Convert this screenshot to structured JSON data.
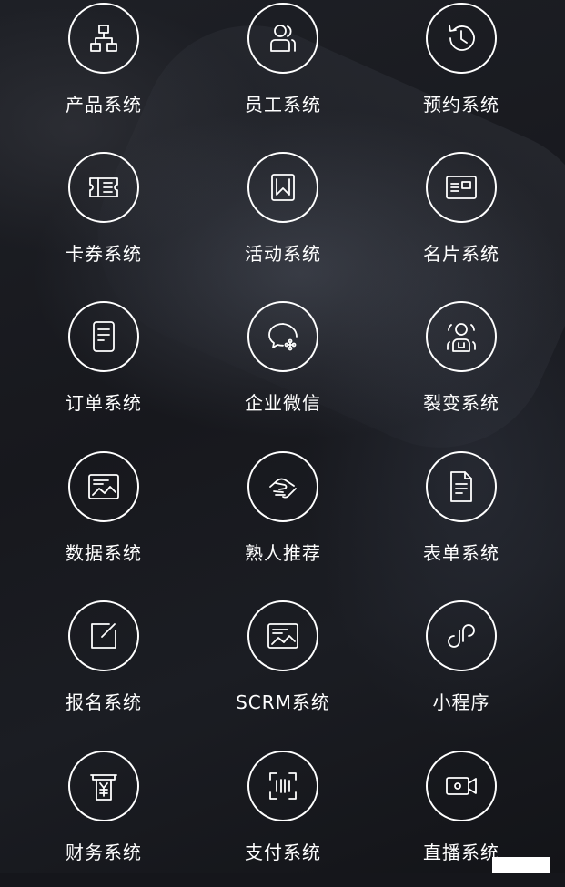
{
  "items": [
    {
      "label": "产品系统",
      "icon": "org-chart-icon"
    },
    {
      "label": "员工系统",
      "icon": "staff-icon"
    },
    {
      "label": "预约系统",
      "icon": "history-clock-icon"
    },
    {
      "label": "卡券系统",
      "icon": "coupon-icon"
    },
    {
      "label": "活动系统",
      "icon": "bookmark-icon"
    },
    {
      "label": "名片系统",
      "icon": "business-card-icon"
    },
    {
      "label": "订单系统",
      "icon": "order-document-icon"
    },
    {
      "label": "企业微信",
      "icon": "wecom-chat-icon"
    },
    {
      "label": "裂变系统",
      "icon": "fission-users-icon"
    },
    {
      "label": "数据系统",
      "icon": "data-image-icon"
    },
    {
      "label": "熟人推荐",
      "icon": "handshake-icon"
    },
    {
      "label": "表单系统",
      "icon": "form-document-icon"
    },
    {
      "label": "报名系统",
      "icon": "edit-square-icon"
    },
    {
      "label": "SCRM系统",
      "icon": "scrm-image-icon"
    },
    {
      "label": "小程序",
      "icon": "mini-program-icon"
    },
    {
      "label": "财务系统",
      "icon": "yuan-receipt-icon"
    },
    {
      "label": "支付系统",
      "icon": "scan-pay-icon"
    },
    {
      "label": "直播系统",
      "icon": "video-camera-icon"
    }
  ]
}
